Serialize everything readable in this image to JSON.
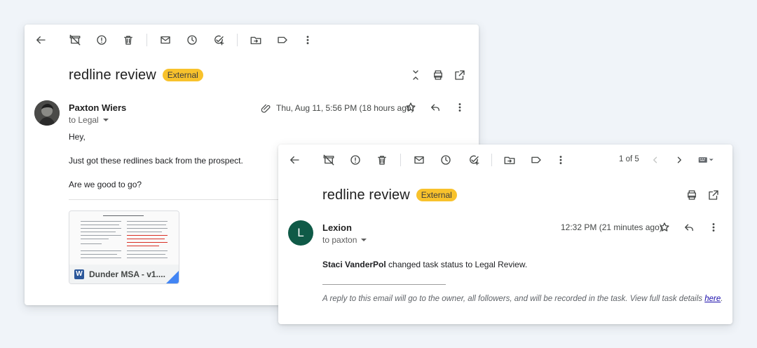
{
  "windows": [
    {
      "subject": "redline review",
      "badge": "External",
      "sender": "Paxton Wiers",
      "to": "to Legal",
      "timestamp": "Thu, Aug 11, 5:56 PM (18 hours ago)",
      "body": [
        "Hey,",
        "Just got these redlines back from the prospect.",
        "Are we good to go?"
      ],
      "attachment": {
        "name": "Dunder MSA - v1....",
        "type_letter": "W"
      }
    },
    {
      "subject": "redline review",
      "badge": "External",
      "pagination": "1 of 5",
      "sender": "Lexion",
      "avatar_letter": "L",
      "to": "to paxton",
      "timestamp": "12:32 PM (21 minutes ago)",
      "status_actor": "Staci VanderPol",
      "status_text": " changed task status to Legal Review.",
      "footer_text": "A reply to this email will go to the owner, all followers, and will be recorded in the task. View full task details ",
      "footer_link": "here",
      "footer_end": "."
    }
  ],
  "colors": {
    "badge": "#f8c22c",
    "lexion_avatar": "#0f5a47",
    "background": "#f0f4f9"
  }
}
